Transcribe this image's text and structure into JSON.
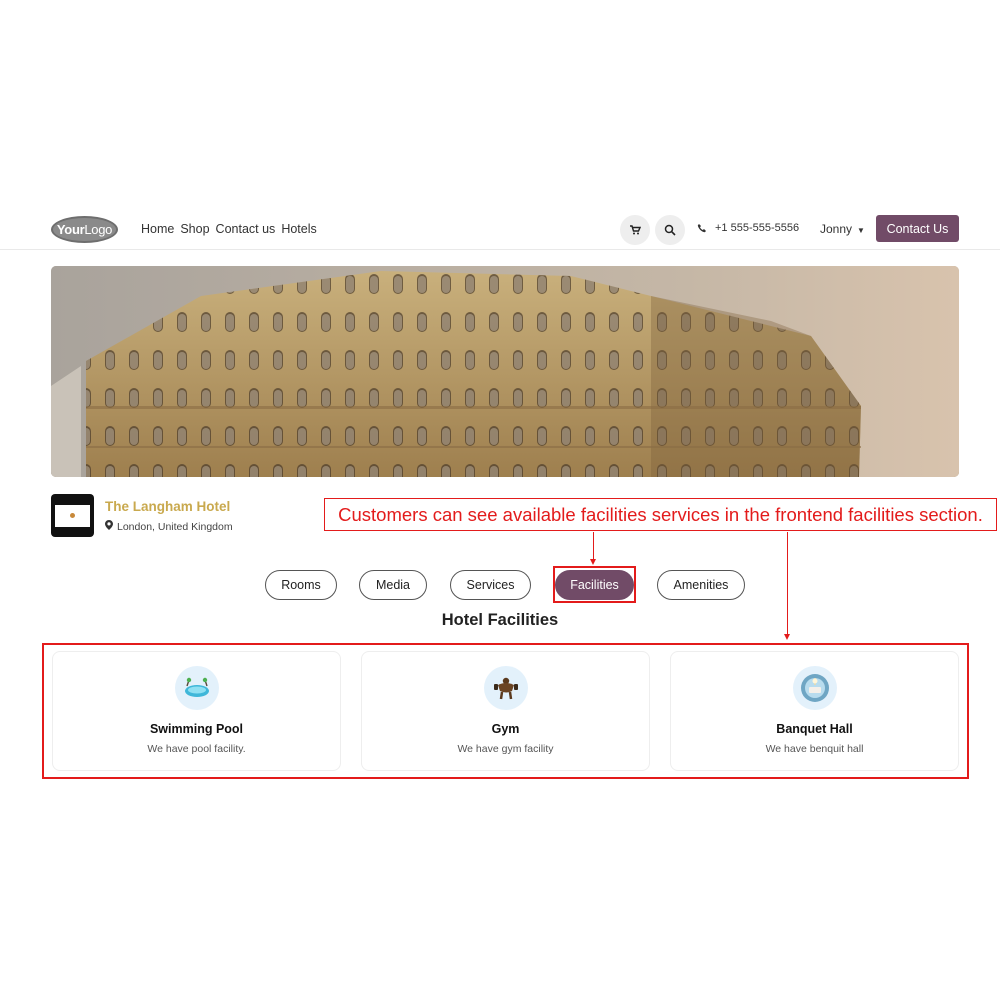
{
  "header": {
    "logo_text_bold": "Your",
    "logo_text_light": "Logo",
    "nav": [
      "Home",
      "Shop",
      "Contact us",
      "Hotels"
    ],
    "phone": "+1 555-555-5556",
    "user": "Jonny",
    "cta_label": "Contact Us",
    "icons": {
      "cart": "cart-icon",
      "search": "search-icon",
      "phone": "phone-icon",
      "caret": "chevron-down-icon"
    }
  },
  "hotel": {
    "name": "The Langham Hotel",
    "location": "London, United Kingdom"
  },
  "annotation": {
    "text": "Customers can see available facilities services in the frontend facilities section.",
    "color": "#e31b1b"
  },
  "tabs": [
    {
      "label": "Rooms",
      "active": false
    },
    {
      "label": "Media",
      "active": false
    },
    {
      "label": "Services",
      "active": false
    },
    {
      "label": "Facilities",
      "active": true
    },
    {
      "label": "Amenities",
      "active": false
    }
  ],
  "section_title": "Hotel Facilities",
  "facilities": [
    {
      "title": "Swimming Pool",
      "desc": "We have pool facility.",
      "icon": "pool-icon"
    },
    {
      "title": "Gym",
      "desc": "We have gym facility",
      "icon": "dumbbell-icon"
    },
    {
      "title": "Banquet Hall",
      "desc": "We have benquit hall",
      "icon": "banquet-icon"
    }
  ],
  "colors": {
    "brand": "#714b67",
    "hotel_name": "#c9a94e",
    "highlight": "#e31b1b",
    "icon_bg": "#e3f1fb"
  }
}
